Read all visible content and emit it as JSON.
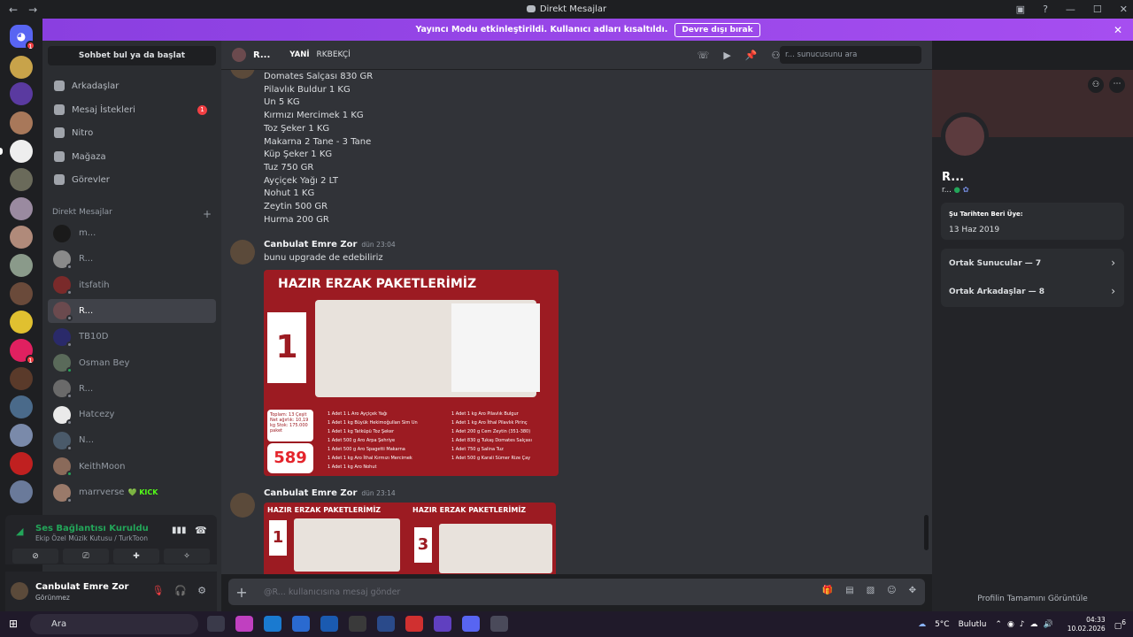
{
  "titlebar": {
    "title": "Direkt Mesajlar",
    "back": "←",
    "forward": "→"
  },
  "banner": {
    "text": "Yayıncı Modu etkinleştirildi. Kullanıcı adları kısaltıldı.",
    "button": "Devre dışı bırak",
    "close": "✕"
  },
  "guilds": {
    "home_badge": "1",
    "badge2": "1",
    "badge3": "1"
  },
  "dm_sidebar": {
    "search_label": "Sohbet bul ya da başlat",
    "nav": [
      {
        "label": "Arkadaşlar"
      },
      {
        "label": "Mesaj İstekleri",
        "badge": "1"
      },
      {
        "label": "Nitro"
      },
      {
        "label": "Mağaza"
      },
      {
        "label": "Görevler"
      }
    ],
    "header": "Direkt Mesajlar",
    "add": "+",
    "dms": [
      {
        "name": "m...",
        "color": "#1a1a1a",
        "status": ""
      },
      {
        "name": "R...",
        "color": "#8a8a8a",
        "status": "#80848e"
      },
      {
        "name": "itsfatih",
        "color": "#7a2a2a",
        "status": "#80848e"
      },
      {
        "name": "R...",
        "color": "#6b4a4e",
        "status": "#80848e"
      },
      {
        "name": "TB10D",
        "color": "#2a2a6a",
        "status": "#80848e"
      },
      {
        "name": "Osman Bey",
        "color": "#5a6a5a",
        "status": "#23a559"
      },
      {
        "name": "R...",
        "color": "#6a6a6a",
        "status": "#80848e"
      },
      {
        "name": "Hatcezy",
        "color": "#eaeaea",
        "status": "#80848e"
      },
      {
        "name": "N...",
        "color": "#4a5a6a",
        "status": "#80848e"
      },
      {
        "name": "KeithMoon",
        "color": "#8a6a5a",
        "status": "#23a559"
      },
      {
        "name": "marrverse",
        "color": "#9a7a6a",
        "status": "#80848e",
        "extra": "💚 KICK"
      }
    ]
  },
  "voice": {
    "title": "Ses Bağlantısı Kuruldu",
    "subtitle": "Ekip Özel Müzik Kutusu / TurkToon"
  },
  "user": {
    "name": "Canbulat Emre Zor",
    "status": "Görünmez"
  },
  "chat_header": {
    "name": "R...",
    "tag": "YANİ",
    "tag2": "RKBEKÇİ",
    "search_placeholder": "r... sunucusunu ara"
  },
  "messages": {
    "list": [
      "Domates Salçası 830 GR",
      "Pilavlık Buldur 1 KG",
      "Un 5 KG",
      "Kırmızı Mercimek 1 KG",
      "Toz Şeker 1 KG",
      "Makarna 2 Tane - 3 Tane",
      "Küp Şeker 1 KG",
      "Tuz 750 GR",
      "Ayçiçek Yağı 2 LT",
      "Nohut 1 KG",
      "Zeytin 500 GR",
      "Hurma 200 GR"
    ],
    "m1": {
      "author": "Canbulat Emre Zor",
      "time": "dün 23:04",
      "text": "bunu upgrade de edebiliriz"
    },
    "m2": {
      "author": "Canbulat Emre Zor",
      "time": "dün 23:14"
    },
    "promo1": {
      "heading": "HAZIR ERZAK PAKETLERİMİZ",
      "paket": "1",
      "price": "589",
      "info": "Toplam: 13 Çeşit Net ağırlık: 10,19 kg Stok: 175.000 paket"
    },
    "promo_list": [
      "1 Adet 1 L Aro Ayçiçek Yağı",
      "1 Adet 1 kg Büyük Hekimoğulları Sim Un",
      "1 Adet 1 kg Tatküpü Toz Şeker",
      "1 Adet 500 g Aro Arpa Şehriye",
      "1 Adet 500 g Aro Spagetti Makarna",
      "1 Adet 1 kg Aro İthal Kırmızı Mercimek",
      "1 Adet 1 kg Aro Nohut",
      "1 Adet 1 kg Aro Pilavlık Bulgur",
      "1 Adet 1 kg Aro İthal Pilavlık Pirinç",
      "1 Adet 200 g Cem Zeytin (351-380)",
      "1 Adet 830 g Tukaş Domates Salçası",
      "1 Adet 750 g Salina Tuz",
      "1 Adet 500 g Karali Sümer Rize Çay"
    ],
    "promo2": {
      "heading_a": "HAZIR ERZAK PAKETLERİMİZ",
      "heading_b": "HAZIR ERZAK PAKETLERİMİZ",
      "paket_a": "1",
      "paket_b": "3"
    }
  },
  "composer": {
    "placeholder": "@R... kullanıcısına mesaj gönder"
  },
  "profile": {
    "name": "R...",
    "tag": "r...",
    "member_since_label": "Şu Tarihten Beri Üye:",
    "member_since": "13 Haz 2019",
    "mutual_servers": "Ortak Sunucular — 7",
    "mutual_friends": "Ortak Arkadaşlar — 8",
    "footer": "Profilin Tamamını Görüntüle"
  },
  "taskbar": {
    "search": "Ara",
    "weather": "5°C",
    "weather_text": "Bulutlu",
    "time": "04:33",
    "date": "10.02.2026",
    "notif": "6"
  }
}
